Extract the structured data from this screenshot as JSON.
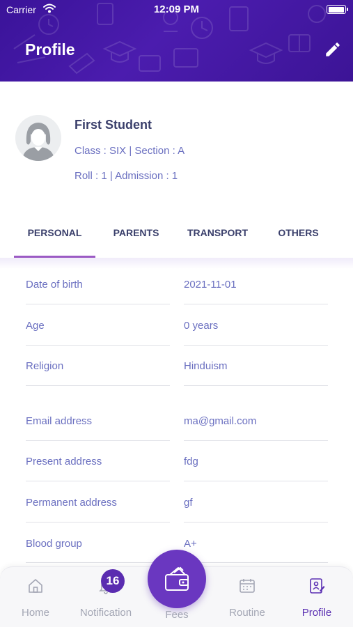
{
  "status_bar": {
    "carrier": "Carrier",
    "time": "12:09 PM"
  },
  "header": {
    "title": "Profile"
  },
  "student": {
    "name": "First Student",
    "class_section": "Class : SIX | Section : A",
    "roll_admission": "Roll : 1 | Admission : 1"
  },
  "tabs": [
    {
      "label": "PERSONAL"
    },
    {
      "label": "PARENTS"
    },
    {
      "label": "TRANSPORT"
    },
    {
      "label": "OTHERS"
    }
  ],
  "personal": [
    {
      "label": "Date of birth",
      "value": "2021-11-01"
    },
    {
      "label": "Age",
      "value": "0 years"
    },
    {
      "label": "Religion",
      "value": "Hinduism"
    },
    {
      "label": "Email address",
      "value": "ma@gmail.com"
    },
    {
      "label": "Present address",
      "value": "fdg"
    },
    {
      "label": "Permanent address",
      "value": "gf"
    },
    {
      "label": "Blood group",
      "value": "A+"
    }
  ],
  "bottom_nav": {
    "home": "Home",
    "notification": "Notification",
    "notification_count": "16",
    "fees": "Fees",
    "routine": "Routine",
    "profile": "Profile"
  },
  "colors": {
    "primary": "#4b1cae",
    "accent": "#6a37c0",
    "text": "#6a6fc0",
    "active_tab": "#9b5ac4"
  }
}
